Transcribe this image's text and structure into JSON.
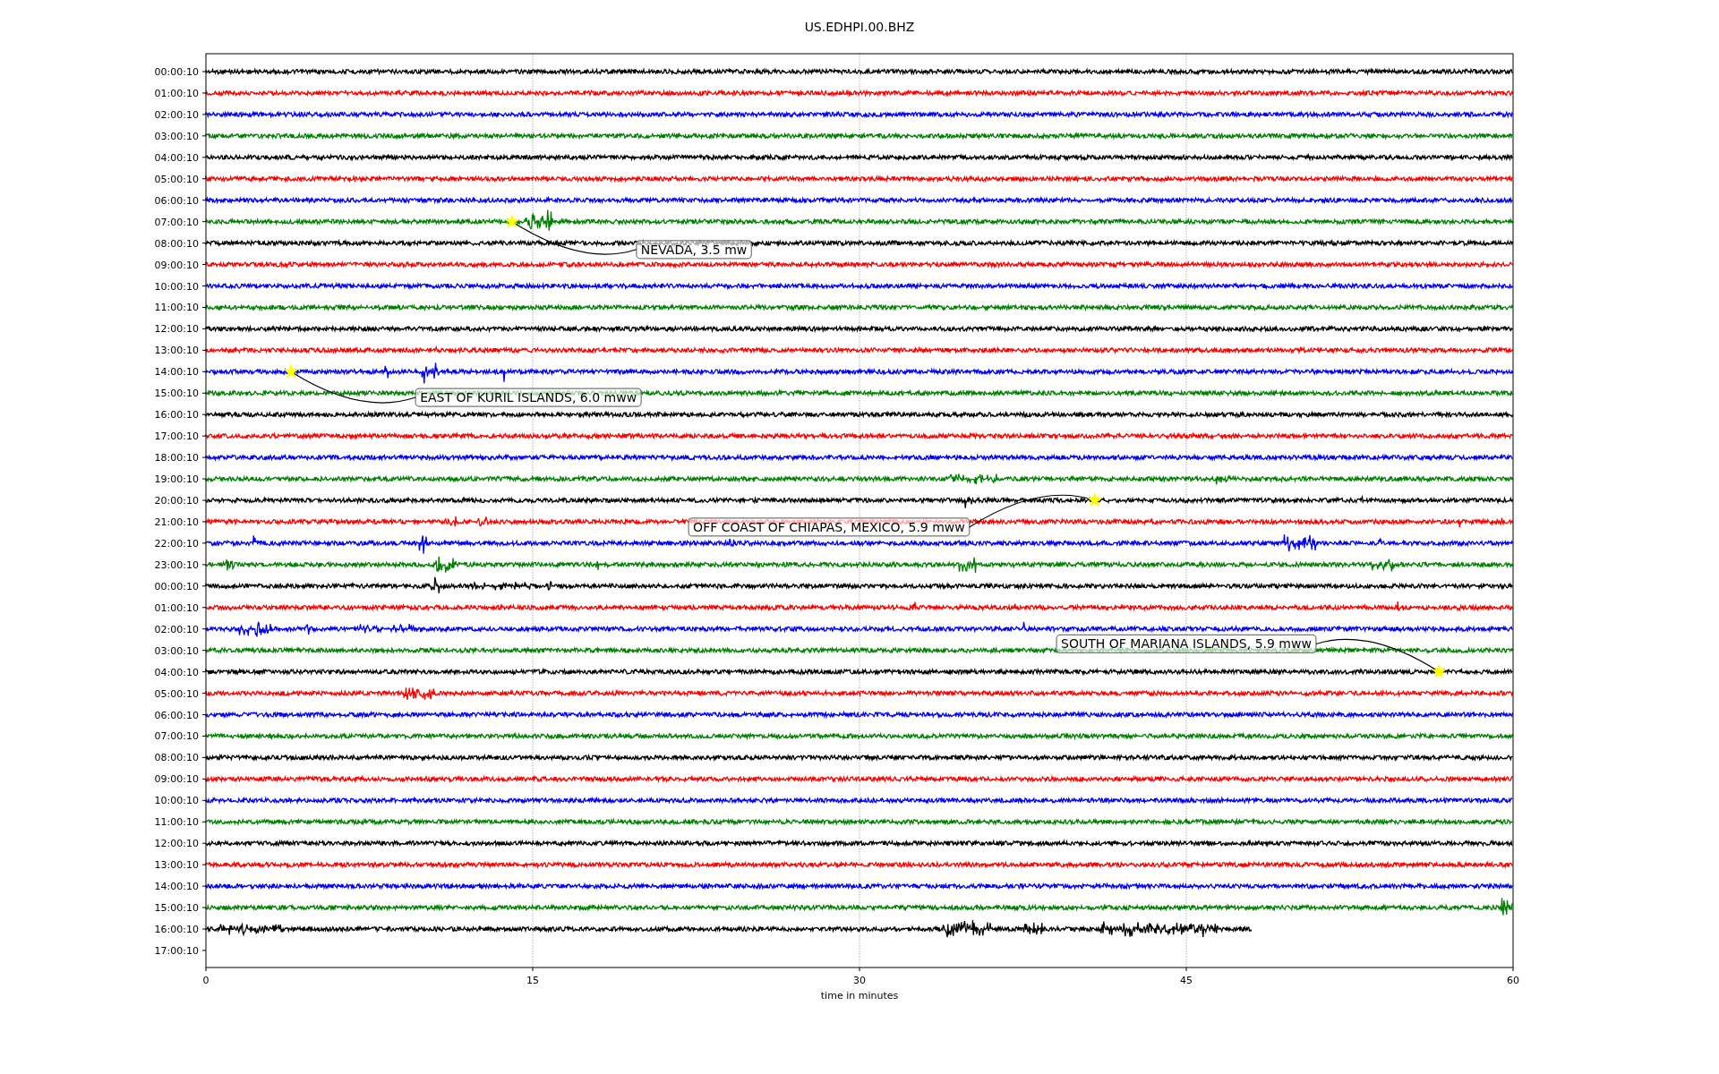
{
  "seismogram": {
    "title": "US.EDHPI.00.BHZ",
    "xlabel": "time in minutes",
    "xticks": [
      "0",
      "15",
      "30",
      "45",
      "60"
    ],
    "row_labels": [
      "00:00:10",
      "01:00:10",
      "02:00:10",
      "03:00:10",
      "04:00:10",
      "05:00:10",
      "06:00:10",
      "07:00:10",
      "08:00:10",
      "09:00:10",
      "10:00:10",
      "11:00:10",
      "12:00:10",
      "13:00:10",
      "14:00:10",
      "15:00:10",
      "16:00:10",
      "17:00:10",
      "18:00:10",
      "19:00:10",
      "20:00:10",
      "21:00:10",
      "22:00:10",
      "23:00:10",
      "00:00:10",
      "01:00:10",
      "02:00:10",
      "03:00:10",
      "04:00:10",
      "05:00:10",
      "06:00:10",
      "07:00:10",
      "08:00:10",
      "09:00:10",
      "10:00:10",
      "11:00:10",
      "12:00:10",
      "13:00:10",
      "14:00:10",
      "15:00:10",
      "16:00:10",
      "17:00:10"
    ],
    "traces": [
      {
        "color": "#000000",
        "kind": "full"
      },
      {
        "color": "#ff0000",
        "kind": "full"
      },
      {
        "color": "#0000ff",
        "kind": "full"
      },
      {
        "color": "#008000",
        "kind": "full"
      },
      {
        "color": "#000000",
        "kind": "full"
      },
      {
        "color": "#ff0000",
        "kind": "full"
      },
      {
        "color": "#0000ff",
        "kind": "full"
      },
      {
        "color": "#008000",
        "kind": "full"
      },
      {
        "color": "#000000",
        "kind": "full"
      },
      {
        "color": "#ff0000",
        "kind": "full"
      },
      {
        "color": "#0000ff",
        "kind": "full"
      },
      {
        "color": "#008000",
        "kind": "full"
      },
      {
        "color": "#000000",
        "kind": "full"
      },
      {
        "color": "#ff0000",
        "kind": "full"
      },
      {
        "color": "#0000ff",
        "kind": "full"
      },
      {
        "color": "#008000",
        "kind": "full"
      },
      {
        "color": "#000000",
        "kind": "full"
      },
      {
        "color": "#ff0000",
        "kind": "full"
      },
      {
        "color": "#0000ff",
        "kind": "full"
      },
      {
        "color": "#008000",
        "kind": "full"
      },
      {
        "color": "#000000",
        "kind": "full"
      },
      {
        "color": "#ff0000",
        "kind": "full"
      },
      {
        "color": "#0000ff",
        "kind": "full"
      },
      {
        "color": "#008000",
        "kind": "full"
      },
      {
        "color": "#000000",
        "kind": "full"
      },
      {
        "color": "#ff0000",
        "kind": "full"
      },
      {
        "color": "#0000ff",
        "kind": "full"
      },
      {
        "color": "#008000",
        "kind": "full"
      },
      {
        "color": "#000000",
        "kind": "full"
      },
      {
        "color": "#ff0000",
        "kind": "full"
      },
      {
        "color": "#0000ff",
        "kind": "full"
      },
      {
        "color": "#008000",
        "kind": "full"
      },
      {
        "color": "#000000",
        "kind": "full"
      },
      {
        "color": "#ff0000",
        "kind": "full"
      },
      {
        "color": "#0000ff",
        "kind": "full"
      },
      {
        "color": "#008000",
        "kind": "full"
      },
      {
        "color": "#000000",
        "kind": "full"
      },
      {
        "color": "#ff0000",
        "kind": "full"
      },
      {
        "color": "#0000ff",
        "kind": "full"
      },
      {
        "color": "#008000",
        "kind": "full"
      },
      {
        "color": "#000000",
        "kind": "partial"
      }
    ],
    "events": [
      {
        "text": "NEVADA, 3.5 mw"
      },
      {
        "text": "EAST OF KURIL ISLANDS, 6.0 mww"
      },
      {
        "text": "OFF COAST OF CHIAPAS, MEXICO, 5.9 mww"
      },
      {
        "text": "SOUTH OF MARIANA ISLANDS, 5.9 mww"
      }
    ]
  }
}
